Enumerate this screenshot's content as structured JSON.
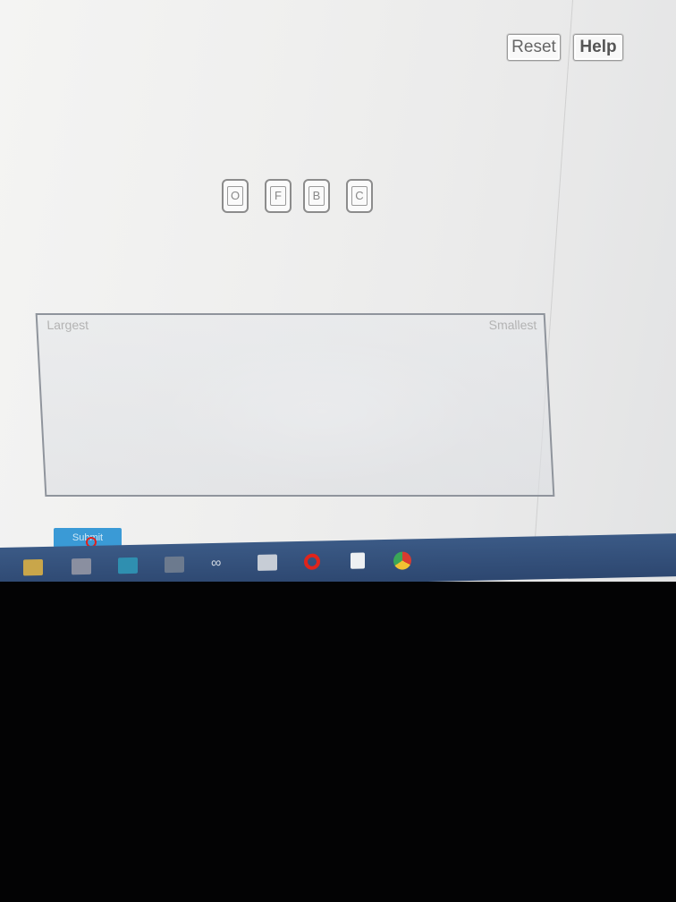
{
  "toolbar": {
    "reset_label": "Reset",
    "help_label": "Help"
  },
  "tiles": [
    {
      "label": "O"
    },
    {
      "label": "F"
    },
    {
      "label": "B"
    },
    {
      "label": "C"
    }
  ],
  "dropzone": {
    "left_label": "Largest",
    "right_label": "Smallest"
  },
  "submit": {
    "label": "Submit"
  },
  "colors": {
    "submit_blue": "#3a9ad6",
    "taskbar": "#34507a"
  },
  "taskbar_icons": [
    "file-explorer-icon",
    "store-icon",
    "app-icon",
    "app-icon",
    "infinity-icon",
    "mail-icon",
    "opera-icon",
    "notes-icon",
    "chrome-icon"
  ]
}
